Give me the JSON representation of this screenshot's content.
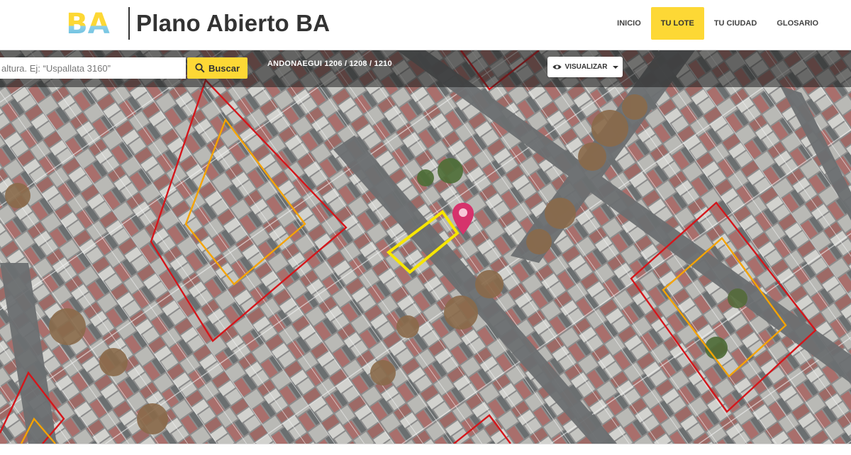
{
  "header": {
    "logo_text": "BA",
    "site_title": "Plano Abierto BA",
    "nav": [
      {
        "label": "INICIO",
        "active": false
      },
      {
        "label": "TU LOTE",
        "active": true
      },
      {
        "label": "TU CIUDAD",
        "active": false
      },
      {
        "label": "GLOSARIO",
        "active": false
      }
    ]
  },
  "toolbar": {
    "search_placeholder": "altura. Ej: “Uspallata 3160”",
    "search_button": "Buscar",
    "address": "ANDONAEGUI 1206 / 1208 / 1210",
    "view_button": "VISUALIZAR"
  },
  "map": {
    "marker_icon": "map-pin-icon",
    "colors": {
      "selected_lot": "#f7e600",
      "block_outline": "#d4161b",
      "buildable_outline": "#f5a300",
      "marker": "#d6336c",
      "accent": "#fdd835"
    }
  }
}
